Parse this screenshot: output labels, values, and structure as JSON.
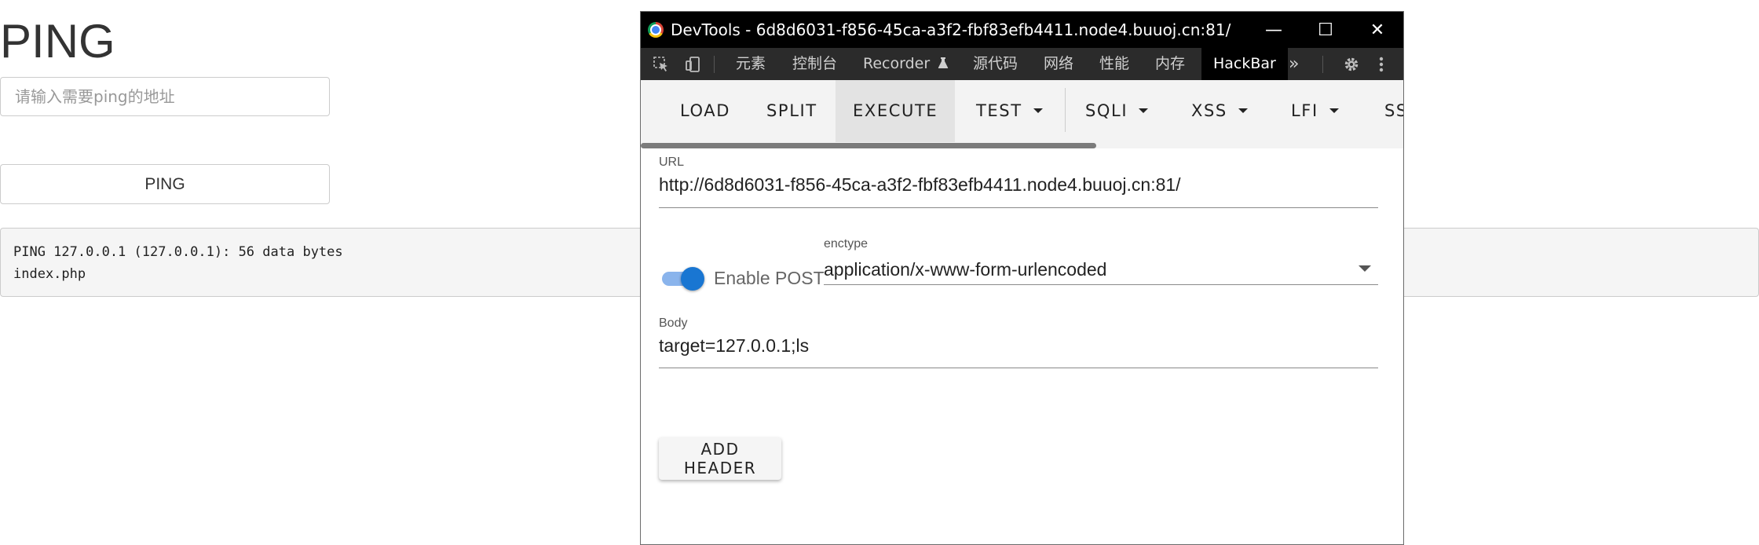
{
  "ping_page": {
    "title": "PING",
    "input_placeholder": "请输入需要ping的地址",
    "button_label": "PING",
    "output_lines": [
      "PING 127.0.0.1 (127.0.0.1): 56 data bytes",
      "index.php"
    ]
  },
  "devtools": {
    "window_title": "DevTools - 6d8d6031-f856-45ca-a3f2-fbf83efb4411.node4.buuoj.cn:81/",
    "window_controls": {
      "minimize": "—",
      "maximize": "☐",
      "close": "✕"
    },
    "tabs": [
      {
        "label": "元素"
      },
      {
        "label": "控制台"
      },
      {
        "label": "Recorder"
      },
      {
        "label": "源代码"
      },
      {
        "label": "网络"
      },
      {
        "label": "性能"
      },
      {
        "label": "内存"
      },
      {
        "label": "HackBar",
        "active": true
      }
    ],
    "more_tabs": "»",
    "icons": [
      "inspect-element-icon",
      "device-toolbar-icon",
      "flask-icon",
      "settings-gear-icon",
      "more-vertical-icon"
    ]
  },
  "hackbar": {
    "buttons": {
      "load": "LOAD",
      "split": "SPLIT",
      "execute": "EXECUTE",
      "test": "TEST",
      "sqli": "SQLI",
      "xss": "XSS",
      "lfi": "LFI",
      "ssti_partial": "SS"
    },
    "url_label": "URL",
    "url_value": "http://6d8d6031-f856-45ca-a3f2-fbf83efb4411.node4.buuoj.cn:81/",
    "enable_post_label": "Enable POST",
    "enable_post_on": true,
    "enctype_label": "enctype",
    "enctype_value": "application/x-www-form-urlencoded",
    "body_label": "Body",
    "body_value": "target=127.0.0.1;ls",
    "add_header_label": "ADD HEADER"
  },
  "colors": {
    "toggle_thumb": "#1976d2",
    "toggle_track": "#8ab4ec",
    "devtools_tabbar": "#2b2b2b",
    "titlebar": "#000000"
  }
}
